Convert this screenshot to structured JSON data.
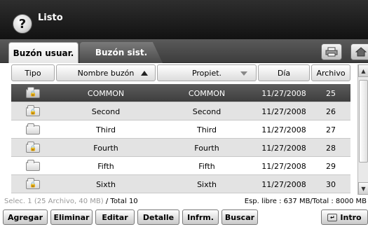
{
  "header": {
    "status": "Listo",
    "help_glyph": "?"
  },
  "tabs": [
    {
      "label": "Buzón usuar.",
      "active": true
    },
    {
      "label": "Buzón sist.",
      "active": false
    }
  ],
  "toolbar_icons": [
    "printer-icon",
    "home-icon"
  ],
  "table": {
    "columns": [
      "Tipo",
      "Nombre buzón",
      "Propiet.",
      "Día",
      "Archivo"
    ],
    "sort_column": "Nombre buzón",
    "rows": [
      {
        "locked": true,
        "name": "COMMON",
        "owner": "COMMON",
        "date": "11/27/2008",
        "files": "25",
        "selected": true
      },
      {
        "locked": true,
        "name": "Second",
        "owner": "Second",
        "date": "11/27/2008",
        "files": "26",
        "selected": false
      },
      {
        "locked": false,
        "name": "Third",
        "owner": "Third",
        "date": "11/27/2008",
        "files": "27",
        "selected": false
      },
      {
        "locked": true,
        "name": "Fourth",
        "owner": "Fourth",
        "date": "11/27/2008",
        "files": "28",
        "selected": false
      },
      {
        "locked": false,
        "name": "Fifth",
        "owner": "Fifth",
        "date": "11/27/2008",
        "files": "29",
        "selected": false
      },
      {
        "locked": true,
        "name": "Sixth",
        "owner": "Sixth",
        "date": "11/27/2008",
        "files": "30",
        "selected": false
      }
    ]
  },
  "footer": {
    "selection": "Selec. 1 (25 Archivo, 40 MB)",
    "total": "/ Total 10",
    "free_space": "Esp. libre : 637 MB/Total : 8000 MB"
  },
  "buttons": {
    "add": "Agregar",
    "delete": "Eliminar",
    "edit": "Editar",
    "detail": "Detalle",
    "report": "Infrm.",
    "search": "Buscar",
    "enter": "Intro"
  }
}
